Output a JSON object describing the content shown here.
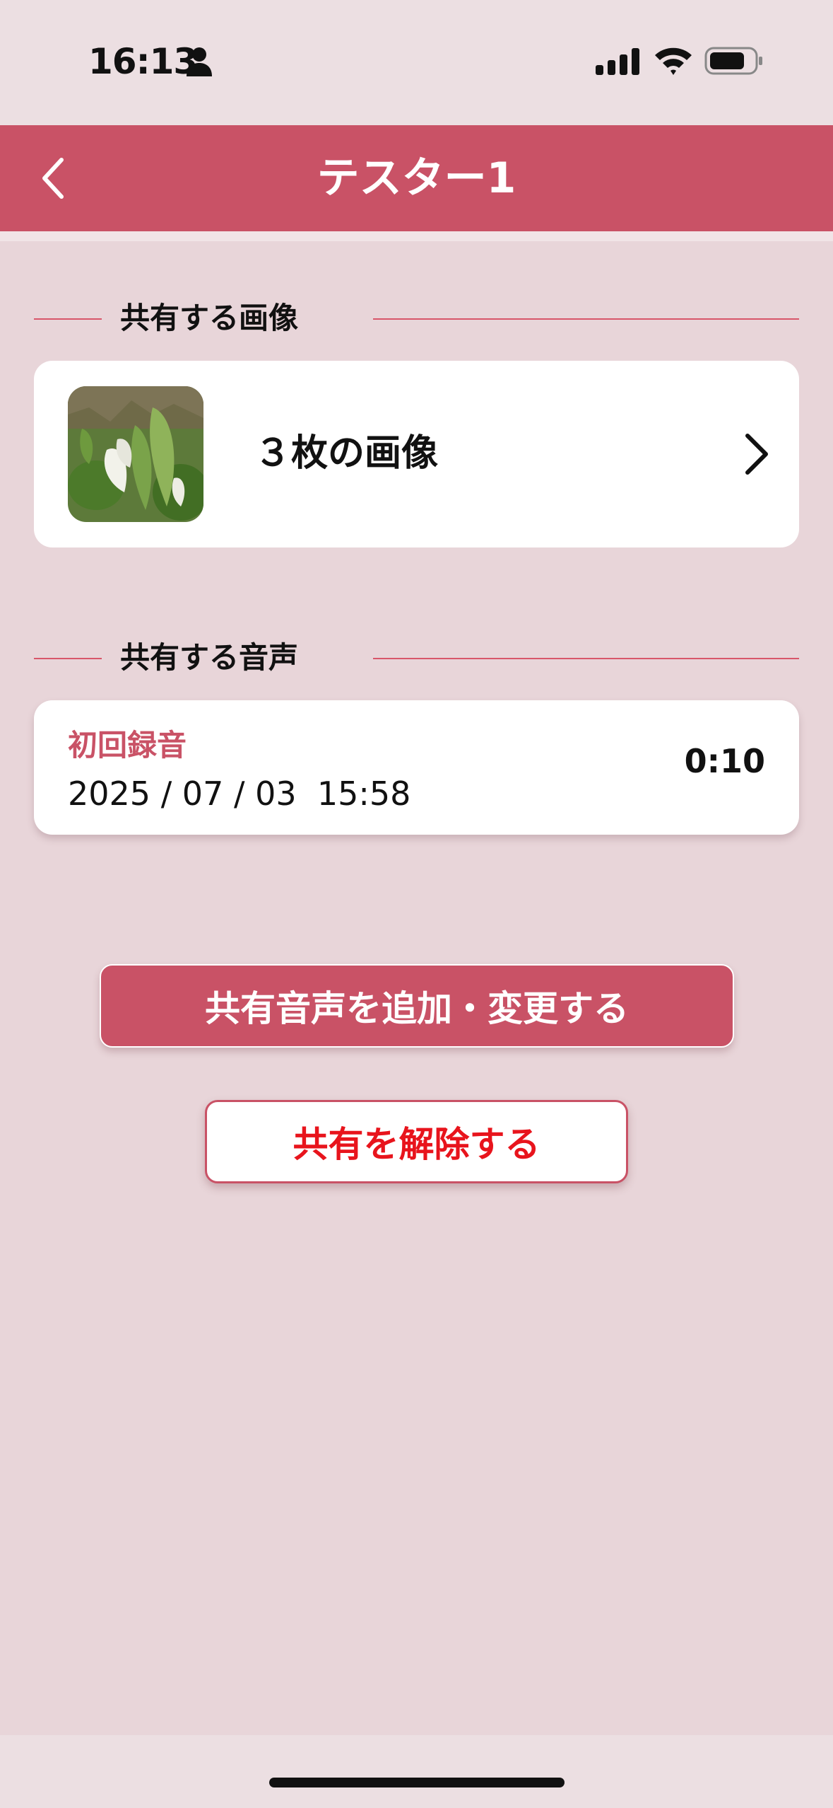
{
  "status_bar": {
    "time": "16:13",
    "icons": [
      "person-icon",
      "signal-icon",
      "wifi-icon",
      "battery-icon"
    ]
  },
  "nav": {
    "back_icon": "chevron-left-icon",
    "title": "テスター1"
  },
  "images_section": {
    "title": "共有する画像",
    "count_label": "３枚の画像",
    "chevron_icon": "chevron-right-icon"
  },
  "audio_section": {
    "title": "共有する音声",
    "recording": {
      "name": "初回録音",
      "date": "2025 / 07 / 03  15:58",
      "duration": "0:10"
    }
  },
  "actions": {
    "add_change_label": "共有音声を追加・変更する",
    "unshare_label": "共有を解除する"
  },
  "colors": {
    "accent": "#c95266",
    "background": "#e8d5d9",
    "danger_text": "#e8141c"
  }
}
